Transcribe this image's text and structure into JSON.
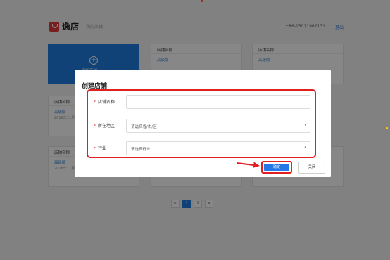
{
  "header": {
    "logo_text": "逸店",
    "subtitle": "我的店铺",
    "phone": "+86-15011962131",
    "logout_label": "退出"
  },
  "add_card": {
    "icon": "plus-circle-icon",
    "label": "添加店铺"
  },
  "shop_cards": [
    {
      "head": "店铺名称",
      "link": "高级版",
      "date": ""
    },
    {
      "head": "店铺名称",
      "link": "高级版",
      "date": ""
    },
    {
      "head": "店铺名称",
      "link": "高级版",
      "date": "2018年11月"
    },
    {
      "head": "店铺名称",
      "link": "高级版",
      "date": "2018年11月"
    }
  ],
  "pagination": {
    "prev": "<",
    "pages": [
      "1",
      "2"
    ],
    "current": "1",
    "next": ">"
  },
  "modal": {
    "title": "创建店铺",
    "fields": {
      "name": {
        "label": "店铺名称",
        "value": ""
      },
      "region": {
        "label": "所在地区",
        "placeholder": "请选择省/市/区"
      },
      "industry": {
        "label": "行业",
        "placeholder": "请选择行业"
      }
    },
    "required_mark": "*",
    "confirm_label": "确定",
    "close_label": "关闭"
  },
  "colors": {
    "brand_red": "#e4393c",
    "primary_blue": "#1f7be0",
    "highlight_red": "#e02020"
  }
}
